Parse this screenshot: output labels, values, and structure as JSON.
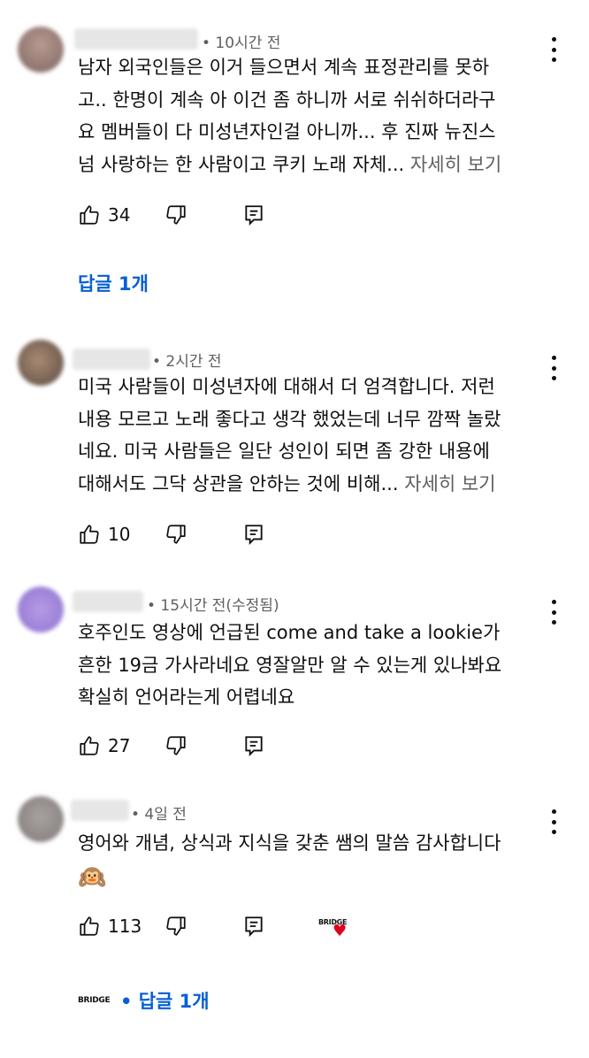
{
  "comments": [
    {
      "time": "• 10시간 전",
      "lines": [
        "남자 외국인들은 이거 들으면서 계속 표정관리를 못하",
        "고.. 한명이 계속 아 이건 좀 하니까 서로 쉬쉬하더라구",
        "요 멤버들이 다 미성년자인걸 아니까... 후 진짜 뉴진스",
        "넘 사랑하는 한 사람이고 쿠키 노래 자체..."
      ],
      "more": " 자세히 보기",
      "likes": "34",
      "replies": "답글 1개"
    },
    {
      "time": "• 2시간 전",
      "lines": [
        "미국 사람들이 미성년자에 대해서 더 엄격합니다. 저런",
        "내용 모르고 노래 좋다고 생각 했었는데 너무 깜짝 놀랐",
        "네요. 미국 사람들은 일단 성인이 되면 좀 강한 내용에",
        "대해서도 그닥 상관을 안하는 것에 비해..."
      ],
      "more": " 자세히 보기",
      "likes": "10"
    },
    {
      "time": "• 15시간 전(수정됨)",
      "lines": [
        "호주인도 영상에 언급된 come and take a lookie가",
        "흔한 19금 가사라네요 영잘알만 알 수 있는게 있나봐요",
        "확실히 언어라는게 어렵네요"
      ],
      "likes": "27"
    },
    {
      "time": "• 4일 전",
      "lines": [
        "영어와 개념, 상식과 지식을 갖춘 쌤의 말씀 감사합니다",
        "🙉"
      ],
      "likes": "113",
      "creator_logo": "BRIDGE",
      "replies": "• 답글 1개"
    }
  ],
  "colors": {
    "reply_link": "#065fd4",
    "meta": "#606060",
    "heart": "#e0001b"
  }
}
